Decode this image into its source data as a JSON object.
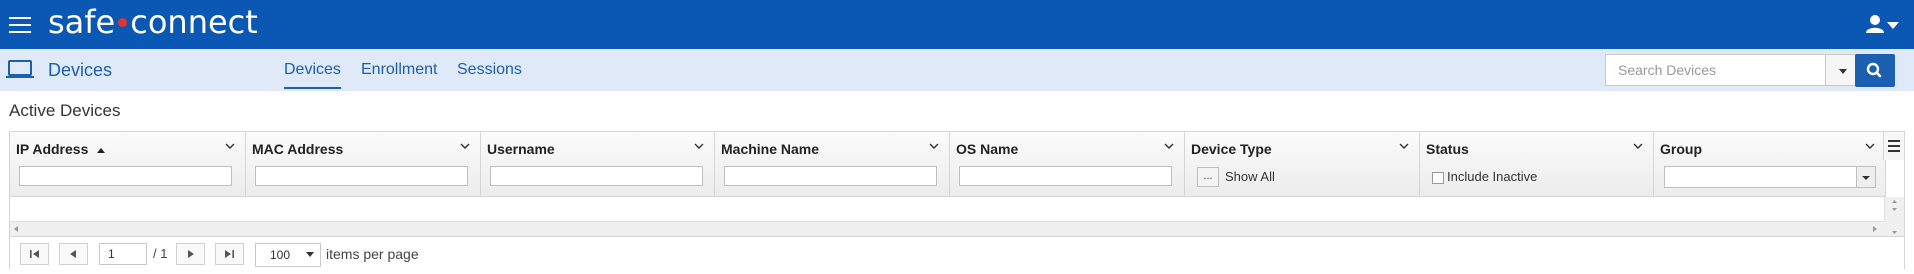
{
  "app": {
    "logo_left": "safe",
    "logo_right": "connect"
  },
  "subnav": {
    "title": "Devices",
    "tabs": [
      {
        "label": "Devices",
        "active": true
      },
      {
        "label": "Enrollment",
        "active": false
      },
      {
        "label": "Sessions",
        "active": false
      }
    ],
    "search": {
      "placeholder": "Search Devices"
    }
  },
  "section_title": "Active Devices",
  "columns": [
    {
      "title": "IP Address",
      "sorted": "asc",
      "filter": "text"
    },
    {
      "title": "MAC Address",
      "filter": "text"
    },
    {
      "title": "Username",
      "filter": "text"
    },
    {
      "title": "Machine Name",
      "filter": "text"
    },
    {
      "title": "OS Name",
      "filter": "text"
    },
    {
      "title": "Device Type",
      "filter": "button",
      "filter_label": "Show All",
      "button_label": "..."
    },
    {
      "title": "Status",
      "filter": "checkbox",
      "filter_label": "Include Inactive"
    },
    {
      "title": "Group",
      "filter": "select"
    }
  ],
  "pager": {
    "current_page": "1",
    "total": "/ 1",
    "page_size": "100",
    "items_per_page_label": "items per page"
  },
  "colors": {
    "topbar": "#0a58b4",
    "subbar": "#dfe9f7",
    "accent": "#1d5fa8",
    "logo_dot": "#e8322b"
  }
}
